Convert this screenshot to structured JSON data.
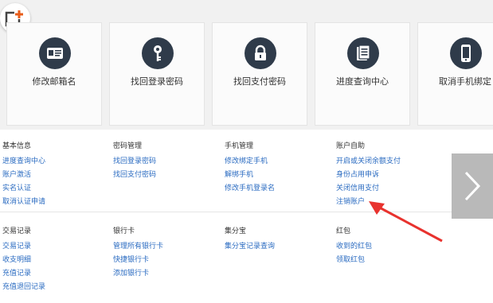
{
  "tiles": [
    {
      "label": "修改邮箱名",
      "icon": "id-card-icon"
    },
    {
      "label": "找回登录密码",
      "icon": "key-icon"
    },
    {
      "label": "找回支付密码",
      "icon": "lock-icon"
    },
    {
      "label": "进度查询中心",
      "icon": "document-icon"
    },
    {
      "label": "取消手机绑定",
      "icon": "phone-icon"
    }
  ],
  "groups": {
    "basic": {
      "title": "基本信息",
      "links": [
        "进度查询中心",
        "账户激活",
        "实名认证",
        "取消认证申请"
      ]
    },
    "password": {
      "title": "密码管理",
      "links": [
        "找回登录密码",
        "找回支付密码"
      ]
    },
    "phone": {
      "title": "手机管理",
      "links": [
        "修改绑定手机",
        "解绑手机",
        "修改手机登录名"
      ]
    },
    "selfservice": {
      "title": "账户自助",
      "links": [
        "开启或关闭余额支付",
        "身份占用申诉",
        "关闭信用支付",
        "注销账户"
      ]
    },
    "transactions": {
      "title": "交易记录",
      "links": [
        "交易记录",
        "收支明细",
        "充值记录",
        "充值退回记录"
      ]
    },
    "bankcard": {
      "title": "银行卡",
      "links": [
        "管理所有银行卡",
        "快捷银行卡",
        "添加银行卡"
      ]
    },
    "jifen": {
      "title": "集分宝",
      "links": [
        "集分宝记录查询"
      ]
    },
    "hongbao": {
      "title": "红包",
      "links": [
        "收到的红包",
        "领取红包"
      ]
    }
  },
  "colors": {
    "link": "#2a6bc1",
    "icon_bg": "#2f3b4a",
    "accent": "#e85c1a",
    "annotation_arrow": "#e8322e"
  }
}
